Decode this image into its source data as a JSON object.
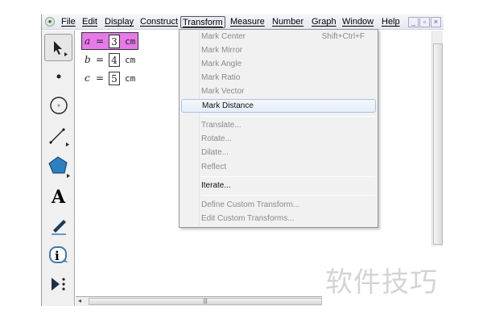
{
  "menubar": {
    "items": [
      "File",
      "Edit",
      "Display",
      "Construct",
      "Transform",
      "Measure",
      "Number",
      "Graph",
      "Window",
      "Help"
    ],
    "active": "Transform"
  },
  "window_controls": {
    "minimize": "_",
    "restore": "▫",
    "close": "×"
  },
  "measurements": [
    {
      "var": "a",
      "eq": "=",
      "value": "3",
      "unit": "cm",
      "selected": true
    },
    {
      "var": "b",
      "eq": "=",
      "value": "4",
      "unit": "cm",
      "selected": false
    },
    {
      "var": "c",
      "eq": "=",
      "value": "5",
      "unit": "cm",
      "selected": false
    }
  ],
  "tools": [
    "arrow-tool",
    "point-tool",
    "compass-tool",
    "straightedge-tool",
    "polygon-tool",
    "text-tool",
    "marker-tool",
    "information-tool",
    "custom-tool"
  ],
  "text_tool_glyph": "A",
  "transform_menu": {
    "items": [
      {
        "label": "Mark Center",
        "shortcut": "Shift+Ctrl+F",
        "enabled": false
      },
      {
        "label": "Mark Mirror",
        "enabled": false
      },
      {
        "label": "Mark Angle",
        "enabled": false
      },
      {
        "label": "Mark Ratio",
        "enabled": false
      },
      {
        "label": "Mark Vector",
        "enabled": false
      },
      {
        "label": "Mark Distance",
        "enabled": true,
        "highlighted": true
      },
      {
        "label": "Translate...",
        "enabled": false
      },
      {
        "label": "Rotate...",
        "enabled": false
      },
      {
        "label": "Dilate...",
        "enabled": false
      },
      {
        "label": "Reflect",
        "enabled": false
      },
      {
        "label": "Iterate...",
        "enabled": true
      },
      {
        "label": "Define Custom Transform...",
        "enabled": false
      },
      {
        "label": "Edit Custom Transforms...",
        "enabled": false
      }
    ]
  },
  "watermark": "软件技巧",
  "colors": {
    "selection": "#e879e8",
    "menu_highlight": "#e6eef9"
  }
}
